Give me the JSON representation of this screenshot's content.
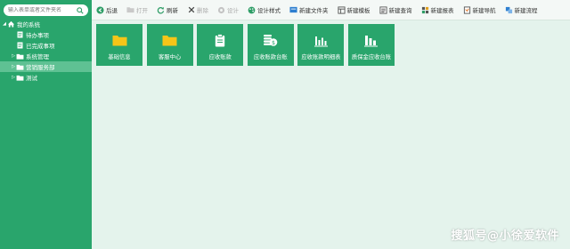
{
  "search": {
    "placeholder": "输入表单或者文件夹名"
  },
  "tree": {
    "root_label": "我的系统",
    "items": [
      {
        "label": "待办事项"
      },
      {
        "label": "已完成事项"
      },
      {
        "label": "系统管理"
      },
      {
        "label": "营销服务部"
      },
      {
        "label": "测试"
      }
    ]
  },
  "toolbar": {
    "back": "后退",
    "open": "打开",
    "refresh": "刷新",
    "delete": "删除",
    "design": "设计",
    "design_style": "设计样式",
    "new_folder": "新建文件夹",
    "new_template": "新建模板",
    "new_query": "新建查询",
    "new_report": "新建报表",
    "new_nav": "新建导航",
    "new_flow": "新建流程"
  },
  "tiles": [
    {
      "label": "基础信息",
      "icon": "folder-icon"
    },
    {
      "label": "客服中心",
      "icon": "folder-icon"
    },
    {
      "label": "应收账款",
      "icon": "clipboard-icon"
    },
    {
      "label": "应收账款台账",
      "icon": "money-icon"
    },
    {
      "label": "应收账款明细表",
      "icon": "bar-chart-icon"
    },
    {
      "label": "质保金应收台账",
      "icon": "bar-chart-icon"
    }
  ],
  "watermark": "搜狐号@小徐爱软件",
  "colors": {
    "sidebar": "#29a56c",
    "tile": "#29a56c",
    "content_bg": "#e4f3ec",
    "active_item": "#5fc193",
    "folder": "#f5c518"
  }
}
